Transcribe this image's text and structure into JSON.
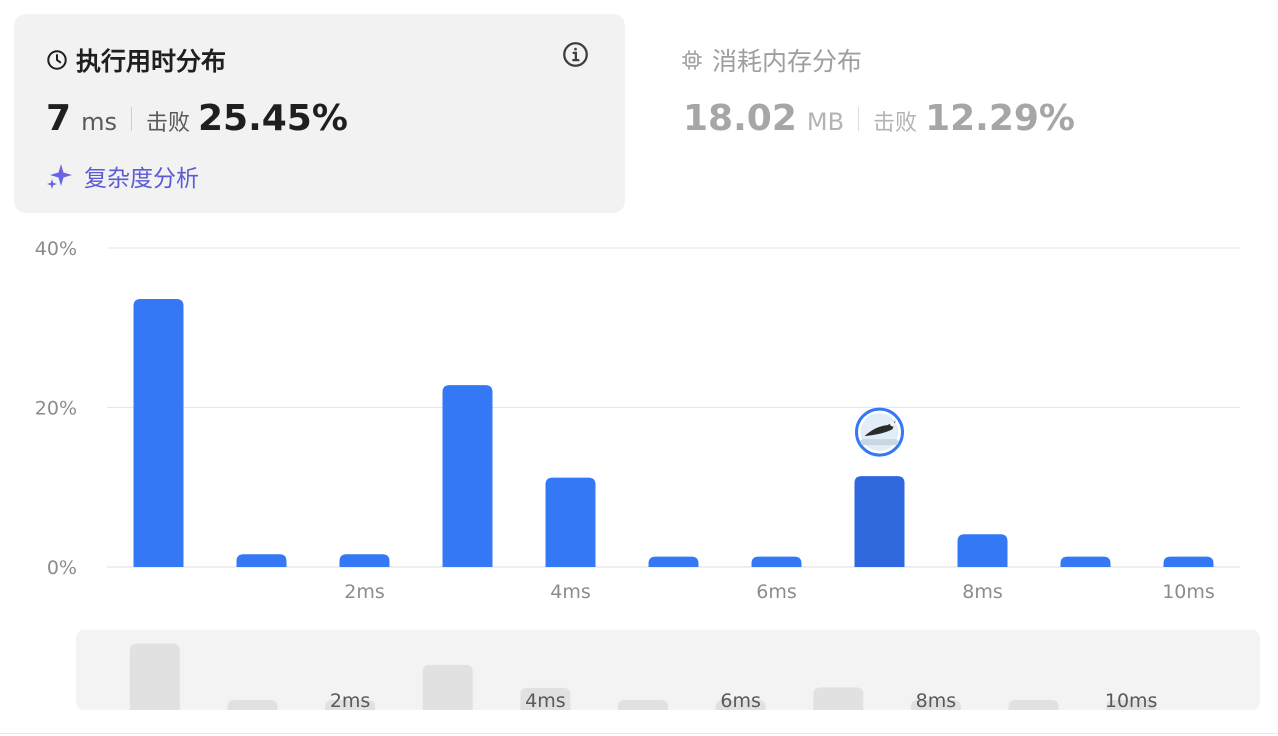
{
  "runtime": {
    "title": "执行用时分布",
    "value": "7",
    "unit": "ms",
    "beat_label": "击败",
    "beat_percent": "25.45%",
    "complexity_link": "复杂度分析"
  },
  "memory": {
    "title": "消耗内存分布",
    "value": "18.02",
    "unit": "MB",
    "beat_label": "击败",
    "beat_percent": "12.29%"
  },
  "colors": {
    "bar": "#3478f6",
    "bar_selected": "#2f67dd",
    "overview_bar": "#e1e1e1",
    "grid": "#e6e6e6"
  },
  "icons": {
    "runtime": "clock-icon",
    "info": "info-icon",
    "sparkle": "sparkle-icon",
    "memory": "chip-icon"
  },
  "chart_data": {
    "type": "bar",
    "x": [
      0,
      1,
      2,
      3,
      4,
      5,
      6,
      7,
      8,
      9,
      10
    ],
    "values": [
      33.6,
      1.6,
      1.6,
      22.8,
      11.2,
      1.3,
      1.3,
      11.4,
      4.1,
      1.3,
      1.3
    ],
    "selected_index": 7,
    "y_ticks": [
      "0%",
      "20%",
      "40%"
    ],
    "ylim": [
      0,
      40
    ],
    "x_tick_labels": {
      "2": "2ms",
      "4": "4ms",
      "6": "6ms",
      "8": "8ms",
      "10": "10ms"
    },
    "grid": true,
    "marker": "user-avatar on selected bar"
  }
}
